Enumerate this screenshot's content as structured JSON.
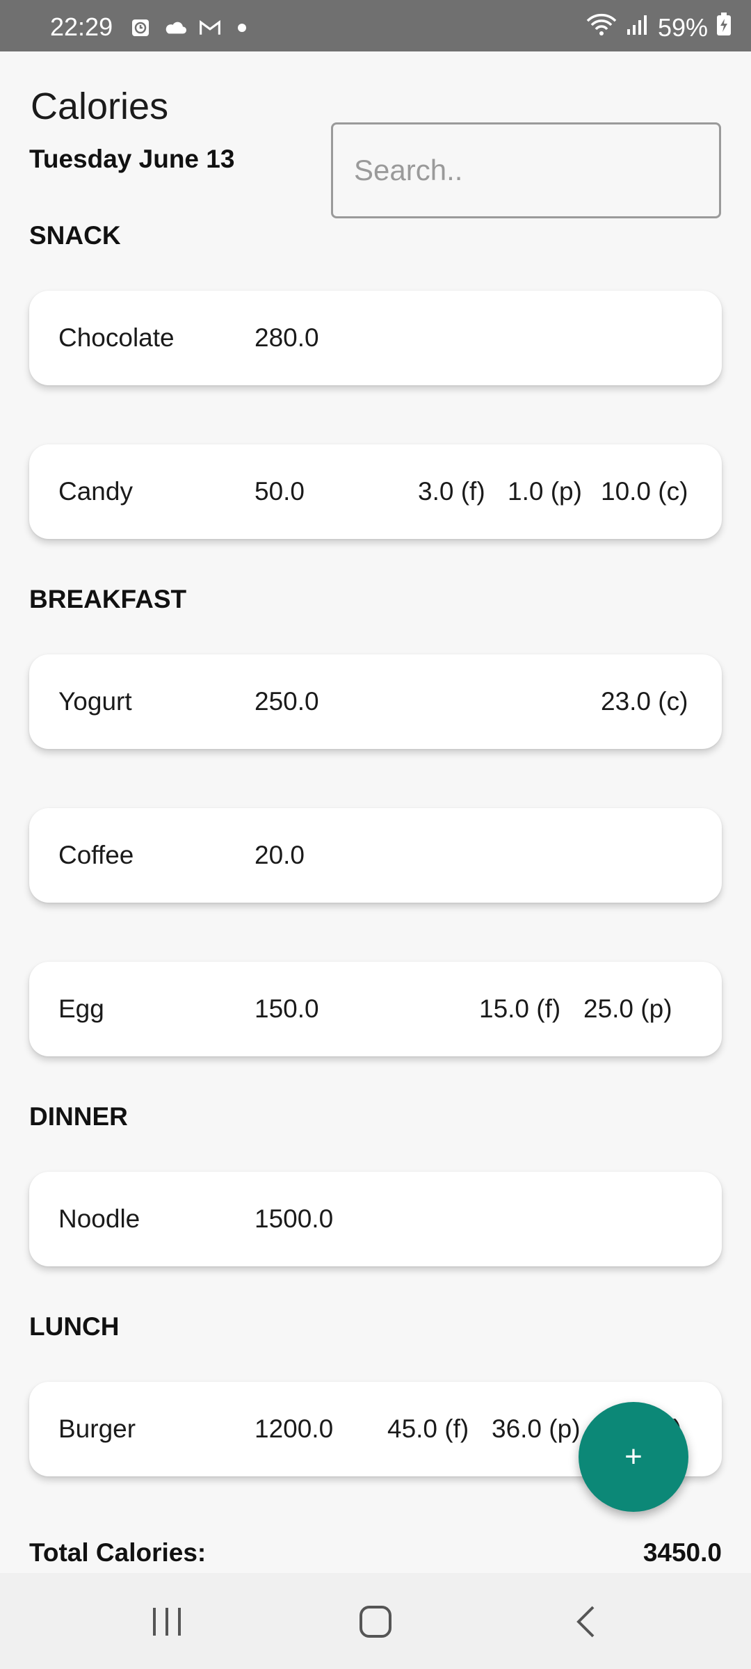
{
  "status_bar": {
    "time": "22:29",
    "battery": "59%"
  },
  "header": {
    "title": "Calories",
    "date": "Tuesday June 13"
  },
  "search": {
    "placeholder": "Search..",
    "value": ""
  },
  "sections": [
    {
      "name": "SNACK",
      "items": [
        {
          "name": "Chocolate",
          "calories": "280.0",
          "macros": []
        },
        {
          "name": "Candy",
          "calories": "50.0",
          "macros": [
            "3.0 (f)",
            "1.0 (p)",
            "10.0 (c)"
          ]
        }
      ]
    },
    {
      "name": "BREAKFAST",
      "items": [
        {
          "name": "Yogurt",
          "calories": "250.0",
          "macros": [
            "23.0 (c)"
          ]
        },
        {
          "name": "Coffee",
          "calories": "20.0",
          "macros": []
        },
        {
          "name": "Egg",
          "calories": "150.0",
          "macros": [
            "15.0 (f)",
            "25.0 (p)"
          ]
        }
      ]
    },
    {
      "name": "DINNER",
      "items": [
        {
          "name": "Noodle",
          "calories": "1500.0",
          "macros": []
        }
      ]
    },
    {
      "name": "LUNCH",
      "items": [
        {
          "name": "Burger",
          "calories": "1200.0",
          "macros": [
            "45.0 (f)",
            "36.0 (p)",
            "(c)"
          ]
        }
      ]
    }
  ],
  "fab": {
    "label": "+",
    "color": "#0c8877"
  },
  "footer": {
    "total_label": "Total Calories:",
    "total_value": "3450.0"
  },
  "nav": {
    "recents_icon": "recents-icon",
    "home_icon": "home-icon",
    "back_icon": "back-icon"
  }
}
